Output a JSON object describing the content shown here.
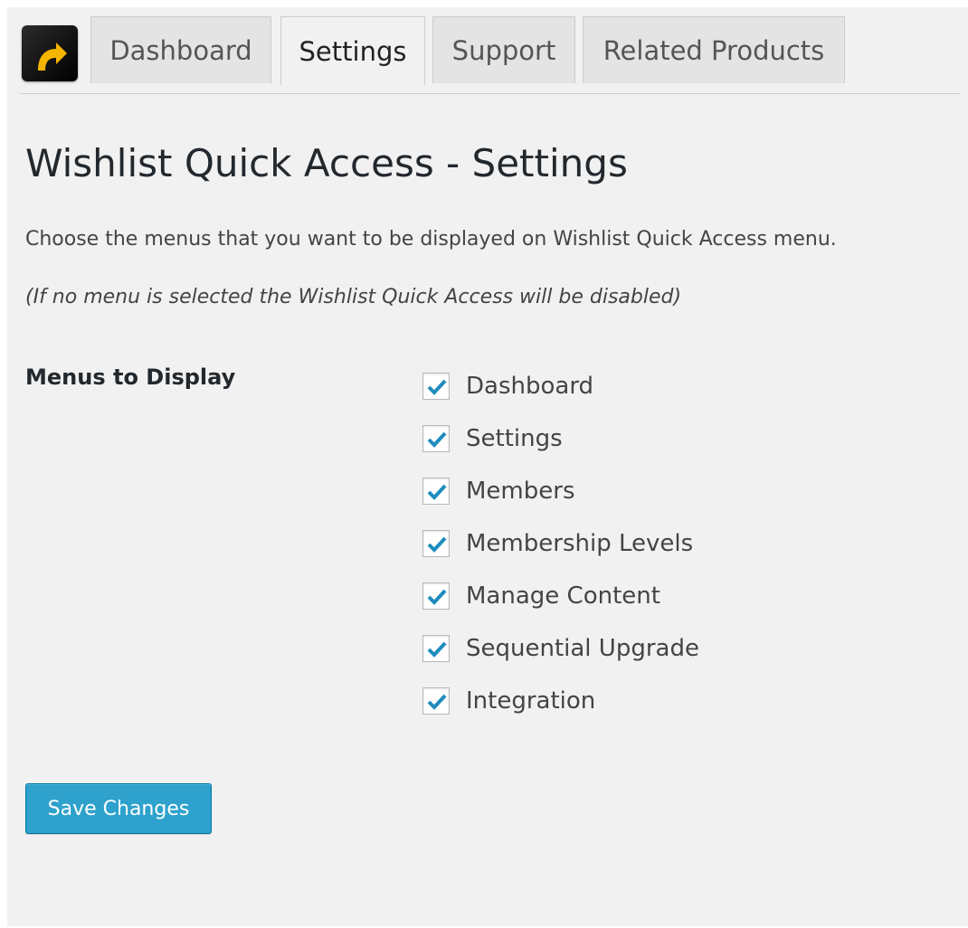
{
  "tabs": [
    {
      "label": "Dashboard",
      "active": false
    },
    {
      "label": "Settings",
      "active": true
    },
    {
      "label": "Support",
      "active": false
    },
    {
      "label": "Related Products",
      "active": false
    }
  ],
  "logo_icon": "wishlist-arrow-icon",
  "page_title": "Wishlist Quick Access - Settings",
  "description": "Choose the menus that you want to be displayed on Wishlist Quick Access menu.",
  "note": "(If no menu is selected the Wishlist Quick Access will be disabled)",
  "menus_field": {
    "label": "Menus to Display",
    "options": [
      {
        "label": "Dashboard",
        "checked": true
      },
      {
        "label": "Settings",
        "checked": true
      },
      {
        "label": "Members",
        "checked": true
      },
      {
        "label": "Membership Levels",
        "checked": true
      },
      {
        "label": "Manage Content",
        "checked": true
      },
      {
        "label": "Sequential Upgrade",
        "checked": true
      },
      {
        "label": "Integration",
        "checked": true
      }
    ]
  },
  "save_button_label": "Save Changes",
  "colors": {
    "accent": "#2ea2cc",
    "checkmark": "#1e8cbe",
    "logo_arrow": "#f5b400",
    "background": "#f1f1f1"
  }
}
